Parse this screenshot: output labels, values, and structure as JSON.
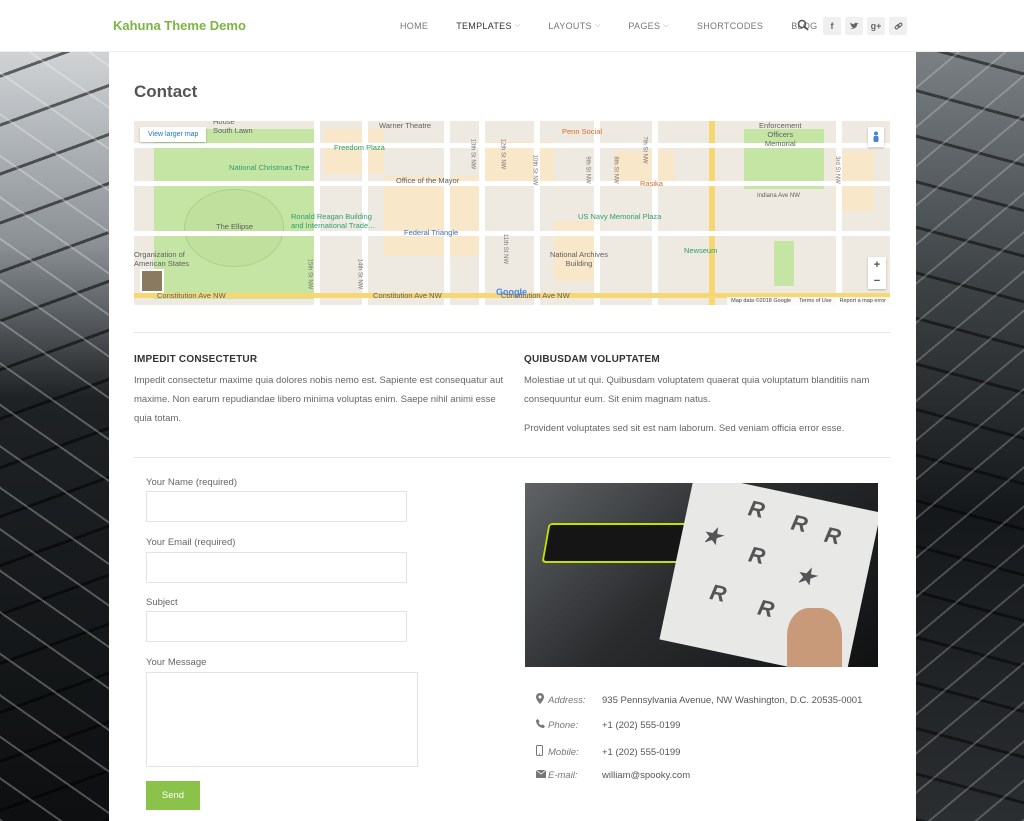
{
  "header": {
    "logo": "Kahuna Theme Demo",
    "nav": [
      {
        "label": "HOME",
        "dropdown": false
      },
      {
        "label": "TEMPLATES",
        "dropdown": true
      },
      {
        "label": "LAYOUTS",
        "dropdown": true
      },
      {
        "label": "PAGES",
        "dropdown": true
      },
      {
        "label": "SHORTCODES",
        "dropdown": false
      },
      {
        "label": "BLOG",
        "dropdown": false
      }
    ],
    "social": [
      "f",
      "t",
      "g+",
      "link"
    ]
  },
  "page": {
    "title": "Contact"
  },
  "map": {
    "view_larger": "View larger map",
    "labels": {
      "house_south_lawn": "House\nSouth Lawn",
      "warner_theatre": "Warner Theatre",
      "enforcement_officers": "Enforcement\nOfficers\nMemorial",
      "freedom_plaza": "Freedom Plaza",
      "penn_social": "Penn Social",
      "national_christmas_tree": "National Christmas Tree",
      "office_mayor": "Office of the Mayor",
      "rasika": "Rasika",
      "the_ellipse": "The Ellipse",
      "ronald_reagan": "Ronald Reagan Building\nand International Trade...",
      "federal_triangle": "Federal Triangle",
      "us_navy": "US Navy Memorial Plaza",
      "organization_american_states": "Organization of\nAmerican States",
      "national_archives": "National Archives\nBuilding",
      "newseum": "Newseum",
      "constitution_1": "Constitution Ave NW",
      "constitution_2": "Constitution Ave NW",
      "constitution_3": "Constitution Ave NW",
      "indiana_ave": "Indiana Ave NW",
      "google": "Google"
    },
    "streets": {
      "s15": "15th St NW",
      "s14": "14th St NW",
      "s13": "13th St NW",
      "s12": "12th St NW",
      "s11": "11th St NW",
      "s10": "10th St NW",
      "s9": "9th St NW",
      "s8": "8th St NW",
      "s7": "7th St NW",
      "s3": "3rd St NW"
    },
    "footer": {
      "data": "Map data ©2018 Google",
      "terms": "Terms of Use",
      "report": "Report a map error"
    },
    "zoom_in": "+",
    "zoom_out": "−"
  },
  "left_column": {
    "heading": "IMPEDIT CONSECTETUR",
    "paragraph": "Impedit consectetur maxime quia dolores nobis nemo est. Sapiente est consequatur aut maxime. Non earum repudiandae libero minima voluptas enim. Saepe nihil animi esse quia totam."
  },
  "right_column": {
    "heading": "QUIBUSDAM VOLUPTATEM",
    "paragraph1": "Molestiae ut ut qui. Quibusdam voluptatem quaerat quia voluptatum blanditiis nam consequuntur eum. Sit enim magnam natus.",
    "paragraph2": "Provident voluptates sed sit est nam laborum. Sed veniam officia error esse."
  },
  "form": {
    "name_label": "Your Name (required)",
    "email_label": "Your Email (required)",
    "subject_label": "Subject",
    "message_label": "Your Message",
    "send_label": "Send"
  },
  "contact": {
    "address_label": "Address:",
    "address_value": "935 Pennsylvania Avenue, NW Washington, D.C. 20535-0001",
    "phone_label": "Phone:",
    "phone_value": "+1 (202) 555-0199",
    "mobile_label": "Mobile:",
    "mobile_value": "+1 (202) 555-0199",
    "email_label": "E-mail:",
    "email_value": "william@spooky.com"
  },
  "icons": {
    "search": "search-icon",
    "address": "map-marker-icon",
    "phone": "phone-icon",
    "mobile": "mobile-icon",
    "email": "envelope-icon"
  },
  "colors": {
    "brand": "#7cb342",
    "button": "#8bc34a"
  }
}
